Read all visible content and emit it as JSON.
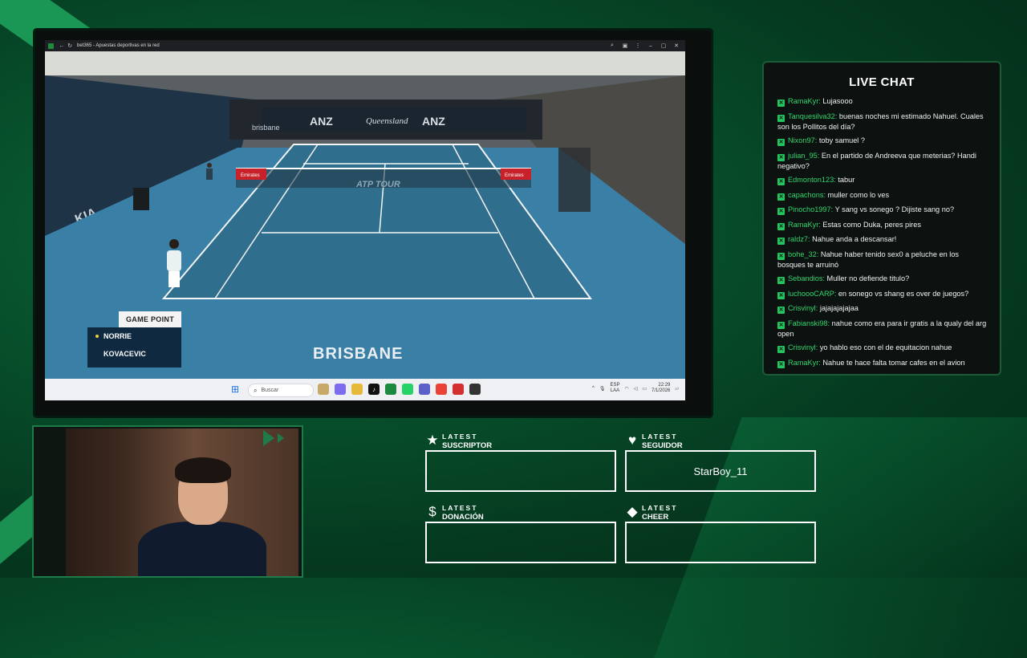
{
  "browser": {
    "title": "bet365 - Apuestas deportivas en la red"
  },
  "video": {
    "game_point_label": "GAME POINT",
    "players": [
      {
        "name": "NORRIE",
        "serving": true
      },
      {
        "name": "KOVACEVIC",
        "serving": false
      }
    ],
    "venue": "BRISBANE",
    "banners": [
      "ANZ",
      "Queensland",
      "ANZ",
      "Emirates",
      "Emirates",
      "ATP TOUR",
      "KIA",
      "brisbane"
    ]
  },
  "taskbar": {
    "search_placeholder": "Buscar",
    "lang_top": "ESP",
    "lang_bottom": "LAA",
    "time": "22:29",
    "date": "7/1/2026"
  },
  "chat": {
    "title": "LIVE CHAT",
    "messages": [
      {
        "user": "RamaKyr:",
        "text": " Lujasooo"
      },
      {
        "user": "Tanquesilva32:",
        "text": " buenas noches mi estimado Nahuel. Cuales son los Pollitos del día?"
      },
      {
        "user": "Nixon97:",
        "text": " toby samuel ?"
      },
      {
        "user": "julian_95:",
        "text": " En el partido de Andreeva que meterias? Handi negativo?"
      },
      {
        "user": "Edmonton123:",
        "text": " tabur"
      },
      {
        "user": "capachons:",
        "text": " muller como lo ves"
      },
      {
        "user": "Pinocho1997:",
        "text": " Y sang vs sonego ? Dijiste sang no?"
      },
      {
        "user": "RamaKyr:",
        "text": " Estas como Duka, peres pires"
      },
      {
        "user": "raldz7:",
        "text": " Nahue anda a descansar!"
      },
      {
        "user": "bohe_32:",
        "text": " Nahue haber tenido sex0 a peluche en los bosques te arruinó"
      },
      {
        "user": "Sebandios:",
        "text": " Muller no defiende titulo?"
      },
      {
        "user": "luchoooCARP:",
        "text": " en sonego vs shang es over de juegos?"
      },
      {
        "user": "Crisvinyl:",
        "text": " jajajajajajaa"
      },
      {
        "user": "Fabianski98:",
        "text": " nahue como era para ir gratis a la qualy del arg open"
      },
      {
        "user": "Crisvinyl:",
        "text": " yo hablo eso con el de equitacion nahue"
      },
      {
        "user": "RamaKyr:",
        "text": " Nahue te hace falta tomar cafes en el avion"
      }
    ]
  },
  "latest": {
    "suscriptor": {
      "line1": "LATEST",
      "line2": "SUSCRIPTOR",
      "value": "",
      "icon": "star-icon"
    },
    "seguidor": {
      "line1": "LATEST",
      "line2": "SEGUIDOR",
      "value": "StarBoy_11",
      "icon": "heart-icon"
    },
    "donacion": {
      "line1": "LATEST",
      "line2": "DONACIÓN",
      "value": "",
      "icon": "dollar-icon"
    },
    "cheer": {
      "line1": "LATEST",
      "line2": "CHEER",
      "value": "",
      "icon": "diamond-icon"
    }
  }
}
